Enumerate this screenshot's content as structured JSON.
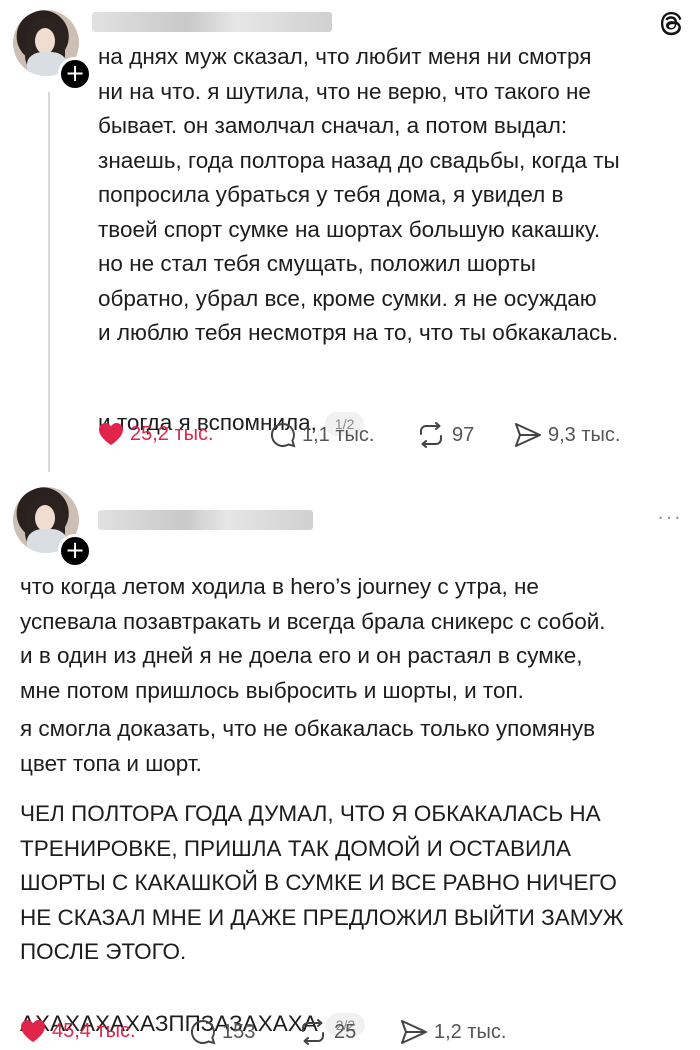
{
  "posts": [
    {
      "text_main": "на днях муж сказал, что любит меня ни смотря\nни на что. я шутила, что не верю, что такого не\nбывает. он замолчал сначал, а потом выдал:\nзнаешь, года полтора назад до свадьбы, когда ты\nпопросила убраться у тебя дома, я увидел в\nтвоей спорт сумке на шортах большую какашку.\nно не стал тебя смущать, положил шорты\nобратно, убрал все, кроме сумки. я не осуждаю\nи люблю тебя несмотря на то, что ты обкакалась.",
      "text_tail": "и тогда я вспомнила,",
      "page_counter": "1/2",
      "likes": "25,2 тыс.",
      "comments": "1,1 тыс.",
      "reposts": "97",
      "shares": "9,3 тыс."
    },
    {
      "text_p1": "что когда летом ходила в hero’s journey с утра, не\nуспевала позавтракать и всегда брала сникерс с собой.\nи в один из дней я не доела его и он растаял в сумке,\nмне потом пришлось выбросить и шорты, и топ.",
      "text_p2": "я смогла доказать, что не обкакалась только упомянув\nцвет топа и шорт.",
      "text_p3": "ЧЕЛ ПОЛТОРА ГОДА ДУМАЛ, ЧТО Я ОБКАКАЛАСЬ НА\nТРЕНИРОВКЕ, ПРИШЛА ТАК ДОМОЙ И ОСТАВИЛА\nШОРТЫ С КАКАШКОЙ В СУМКЕ И ВСЕ РАВНО НИЧЕГО\nНЕ СКАЗАЛ МНЕ И ДАЖЕ ПРЕДЛОЖИЛ ВЫЙТИ ЗАМУЖ\nПОСЛЕ ЭТОГО.",
      "text_tail": "АХАХАХАХАЗППЗАЗАХАХА",
      "page_counter": "2/2",
      "likes": "45,4 тыс.",
      "comments": "153",
      "reposts": "25",
      "shares": "1,2 тыс."
    }
  ],
  "more_label": "···",
  "icons": [
    "threads-logo-icon",
    "heart-icon",
    "comment-icon",
    "repost-icon",
    "share-icon",
    "plus-icon",
    "more-icon"
  ],
  "colors": {
    "like": "#e0244a",
    "text": "#1d1d1d",
    "muted": "#555555"
  }
}
